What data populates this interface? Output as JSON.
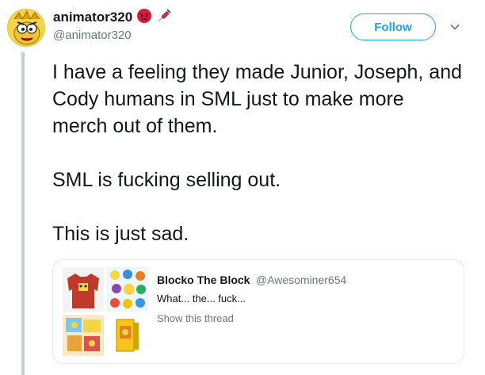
{
  "author": {
    "display_name": "animator320",
    "handle": "@animator320",
    "emoji_icons": [
      "angry-face-emoji",
      "syringe-emoji"
    ]
  },
  "follow_button": {
    "label": "Follow"
  },
  "menu": {
    "icon": "chevron-down-icon"
  },
  "tweet": {
    "paragraphs": [
      "I have a feeling they made Junior, Joseph, and Cody humans in SML just to make more merch out of them.",
      "SML is fucking selling out.",
      "This is just sad."
    ]
  },
  "quoted_tweet": {
    "author_name": "Blocko The Block",
    "author_handle": "@Awesominer654",
    "text": "What... the... fuck...",
    "link_text": "Show this thread",
    "media_thumbnails": [
      "red-sweater-merch",
      "character-sticker-sheet",
      "character-print-collage",
      "plush-box-product"
    ]
  },
  "colors": {
    "accent": "#1da1f2",
    "text_primary": "#14171a",
    "text_secondary": "#657786",
    "border": "#e1e8ed",
    "thread_line": "#c4cfd6"
  }
}
